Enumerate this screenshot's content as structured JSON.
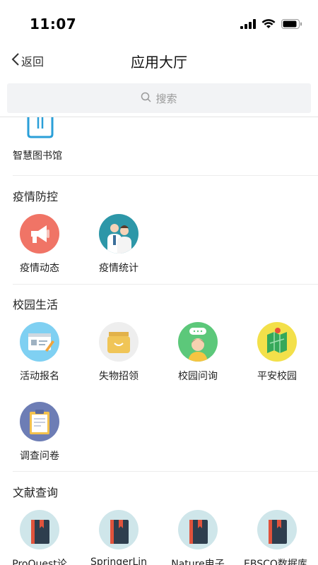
{
  "status": {
    "time": "11:07"
  },
  "nav": {
    "back_label": "返回",
    "title": "应用大厅"
  },
  "search": {
    "placeholder": "搜索"
  },
  "sections": [
    {
      "title": "",
      "apps": [
        {
          "label": "智慧图书馆",
          "icon": "library-icon"
        }
      ]
    },
    {
      "title": "疫情防控",
      "apps": [
        {
          "label": "疫情动态",
          "icon": "megaphone-icon"
        },
        {
          "label": "疫情统计",
          "icon": "doctors-icon"
        }
      ]
    },
    {
      "title": "校园生活",
      "apps": [
        {
          "label": "活动报名",
          "icon": "registration-card-icon"
        },
        {
          "label": "失物招领",
          "icon": "shopping-bag-icon"
        },
        {
          "label": "校园问询",
          "icon": "student-speech-icon"
        },
        {
          "label": "平安校园",
          "icon": "campus-map-icon"
        },
        {
          "label": "调查问卷",
          "icon": "clipboard-icon"
        }
      ]
    },
    {
      "title": "文献查询",
      "apps": [
        {
          "label": "ProQuest论",
          "icon": "book-icon"
        },
        {
          "label": "SpringerLin",
          "icon": "book-icon"
        },
        {
          "label": "Nature电子",
          "icon": "book-icon"
        },
        {
          "label": "EBSCO数据库",
          "icon": "book-icon"
        }
      ]
    }
  ],
  "colors": {
    "megaphone_bg": "#f07466",
    "doctors_bg": "#2d97a8",
    "registration_bg": "#7fd0f2",
    "bag_bg": "#eeeeee",
    "student_bg": "#5cc87a",
    "map_bg": "#f3e04a",
    "clipboard_bg": "#6d7db5",
    "book_bg": "#cfe6ea",
    "library_stroke": "#2a9fd8"
  }
}
